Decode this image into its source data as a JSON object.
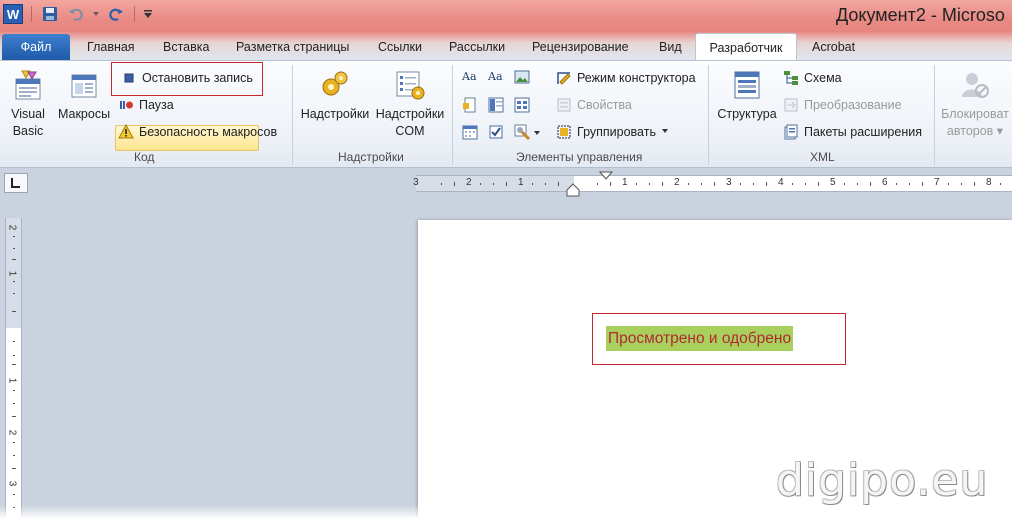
{
  "title": "Документ2 - Microso",
  "quick_access": {
    "app_icon_letter": "W",
    "icons": [
      "save-icon",
      "undo-icon",
      "redo-icon",
      "customize-qat-icon"
    ]
  },
  "tabs": {
    "file": "Файл",
    "items": [
      "Главная",
      "Вставка",
      "Разметка страницы",
      "Ссылки",
      "Рассылки",
      "Рецензирование",
      "Вид"
    ],
    "active": "Разработчик",
    "after": "Acrobat"
  },
  "ribbon": {
    "code": {
      "label": "Код",
      "visual_basic": "Visual Basic",
      "visual_basic_line1": "Visual",
      "visual_basic_line2": "Basic",
      "macros": "Макросы",
      "stop_recording": "Остановить запись",
      "pause": "Пауза",
      "macro_security": "Безопасность макросов"
    },
    "addins": {
      "label": "Надстройки",
      "addins_btn": "Надстройки",
      "com_line1": "Надстройки",
      "com_line2": "COM"
    },
    "controls": {
      "label": "Элементы управления",
      "design_mode": "Режим конструктора",
      "properties": "Свойства",
      "group": "Группировать"
    },
    "xml": {
      "label": "XML",
      "structure": "Структура",
      "schema": "Схема",
      "transform": "Преобразование",
      "expansion_packs": "Пакеты расширения"
    },
    "protect": {
      "block_line1": "Блокироват",
      "block_line2": "авторов"
    }
  },
  "rulers": {
    "horizontal_numbers": [
      "3",
      "2",
      "1",
      "1",
      "2",
      "3",
      "4",
      "5",
      "6",
      "7",
      "8"
    ],
    "vertical_numbers": [
      "2",
      "1",
      "1",
      "2",
      "3"
    ]
  },
  "document": {
    "stamp_text": "Просмотрено и одобрено"
  },
  "watermark": "digipo.eu",
  "colors": {
    "stamp_highlight": "#a9d05c",
    "stamp_text": "#b02a34",
    "callout_border": "#c8262c"
  }
}
